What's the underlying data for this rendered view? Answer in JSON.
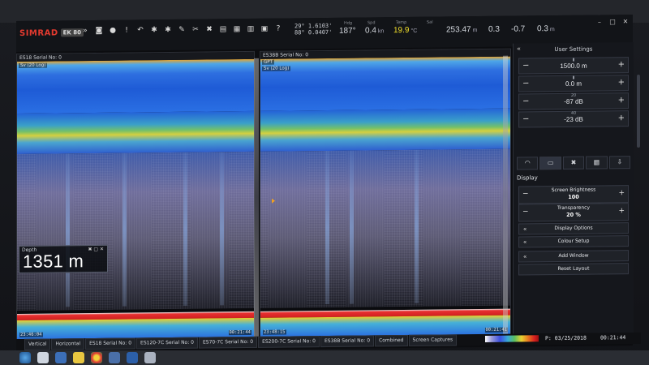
{
  "toolbar": {
    "brand": "SIMRAD",
    "model": "EK 80",
    "icons": [
      "chevrons-down-icon",
      "camera-icon",
      "record-icon",
      "alert-icon",
      "back-icon",
      "gear-icon",
      "wrench-icon",
      "printer-icon",
      "grid-icon"
    ],
    "position_lat": "29° 1.6103'",
    "position_lon": "88° 0.0407'",
    "heading_label": "Hdg",
    "heading": "187°",
    "speed_label": "Spd",
    "speed": "0.4",
    "speed_unit": "kn",
    "temp_label": "Temp",
    "temp": "19.9",
    "temp_unit": "°C",
    "sal_label": "Sal",
    "sal": "253.47",
    "sal_unit": "m",
    "pitch": "0.3",
    "roll": "-0.7",
    "heave": "0.3",
    "heave_unit": "m"
  },
  "panes": {
    "left": {
      "title": "ES18 Serial No: 0",
      "sv_label": "Sv (20 Log)",
      "time_left": "23:46:04",
      "time_right": "00:21:44"
    },
    "right": {
      "title": "ES38B Serial No: 0",
      "gpt_label": "GPT",
      "sv_label": "Sv (20 Log)",
      "time_left": "23:48:15",
      "time_right": "00:21:41"
    }
  },
  "depth": {
    "label": "Depth",
    "value": "1351 m"
  },
  "panel": {
    "title": "User Settings",
    "range": "1500.0 m",
    "start": "0.0 m",
    "gain_sub": "20",
    "gain": "-87 dB",
    "thresh_sub": "40",
    "thresh": "-23 dB",
    "tabs": [
      "signal-icon",
      "monitor-icon",
      "tools-icon",
      "layout-icon",
      "download-icon"
    ],
    "section": "Display",
    "brightness_label": "Screen Brightness",
    "brightness": "100",
    "transparency_label": "Transparency",
    "transparency": "20 %",
    "buttons": [
      "Display Options",
      "Colour Setup",
      "Add Window",
      "Reset Layout"
    ]
  },
  "bottom_tabs": [
    "Vertical",
    "Horizontal",
    "ES18 Serial No: 0",
    "ES120-7C Serial No: 0",
    "ES70-7C Serial No: 0",
    "ES200-7C Serial No: 0",
    "ES38B Serial No: 0",
    "Combined",
    "Screen Captures"
  ],
  "status": {
    "date": "P: 03/25/2018",
    "time": "00:21:44"
  },
  "colors": {
    "accent_red": "#e33a2f",
    "temp_yellow": "#f2df2c"
  }
}
